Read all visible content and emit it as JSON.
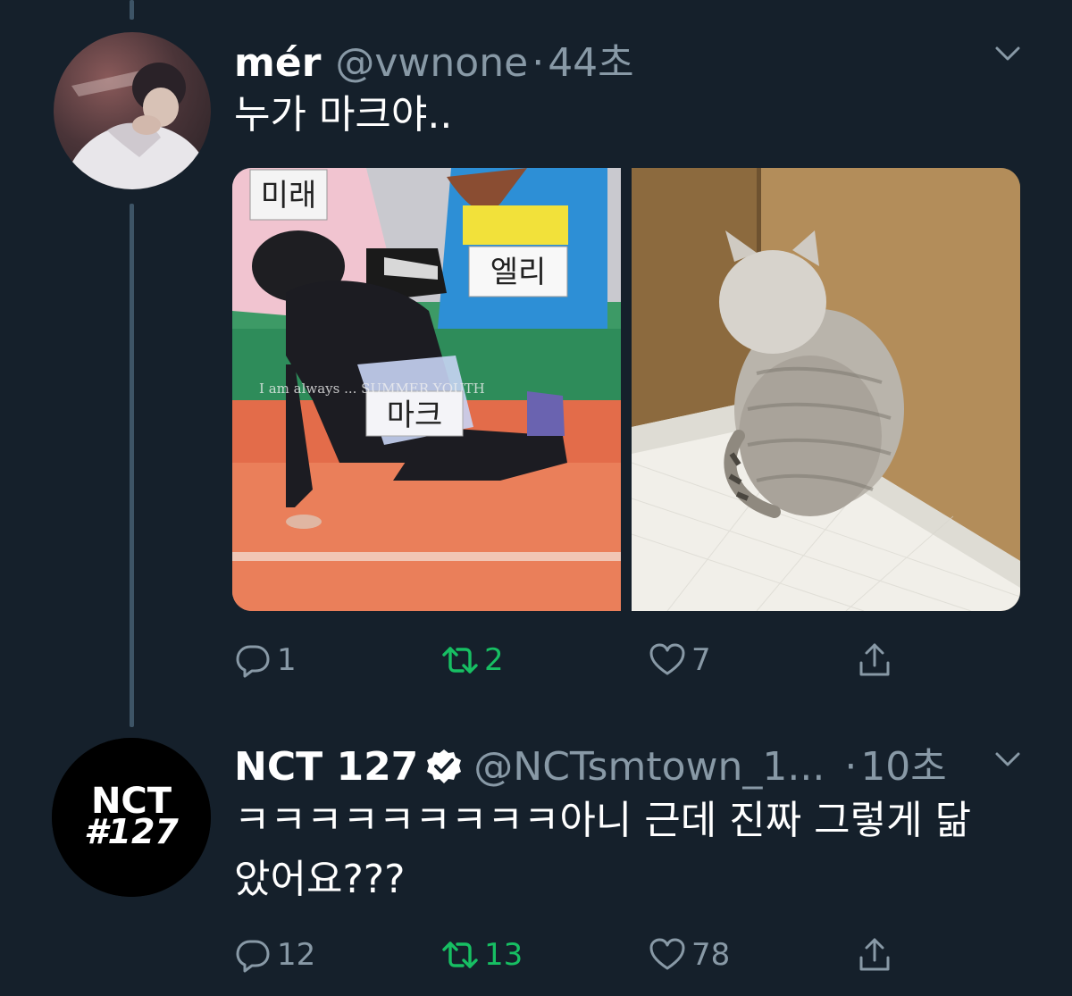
{
  "tweet1": {
    "display_name": "mér",
    "handle": "@vwnone",
    "separator": "·",
    "time": "44초",
    "text": "누가 마크야..",
    "media": {
      "left_photo_badges": [
        "미래",
        "엘리",
        "마크"
      ],
      "left_photo_overlay_text": "I am always ... SUMMER YOUTH"
    },
    "actions": {
      "reply_count": "1",
      "retweet_count": "2",
      "like_count": "7"
    }
  },
  "tweet2": {
    "display_name": "NCT 127",
    "handle": "@NCTsmtown_1...",
    "separator": "·",
    "time": "10초",
    "text_line1": "ㅋㅋㅋㅋㅋㅋㅋㅋㅋ아니 근데 진짜 그렇게 닮",
    "text_line2": "았어요???",
    "avatar_logo_line1": "NCT",
    "avatar_logo_line2": "#127",
    "actions": {
      "reply_count": "12",
      "retweet_count": "13",
      "like_count": "78"
    }
  },
  "icons": [
    "reply-icon",
    "retweet-icon",
    "like-icon",
    "share-icon",
    "chevron-down-icon",
    "verified-badge-icon"
  ],
  "colors": {
    "background": "#15202b",
    "secondary_text": "#8899a6",
    "retweet_green": "#17bf63",
    "thread_line": "#3d5466"
  }
}
